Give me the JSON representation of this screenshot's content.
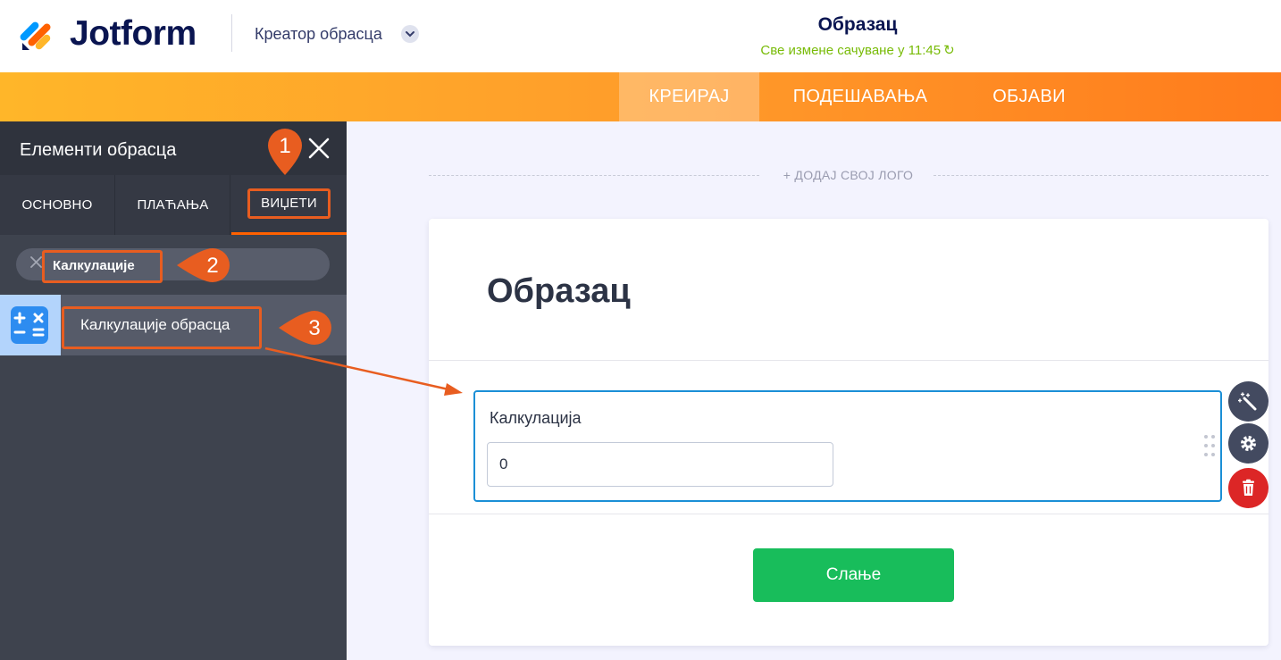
{
  "header": {
    "brand": "Jotform",
    "creator_label": "Креатор обрасца",
    "form_title": "Образац",
    "saved_status": "Све измене сачуване у 11:45"
  },
  "nav": {
    "tabs": [
      {
        "label": "КРЕИРАЈ",
        "active": true
      },
      {
        "label": "ПОДЕШАВАЊА",
        "active": false
      },
      {
        "label": "ОБЈАВИ",
        "active": false
      }
    ]
  },
  "panel": {
    "title": "Елементи обрасца",
    "tabs": [
      "ОСНОВНО",
      "ПЛАЋАЊА",
      "ВИЏЕТИ"
    ],
    "search_value": "Калкулације",
    "result_label": "Калкулације обрасца"
  },
  "canvas": {
    "add_logo": "+ ДОДАЈ СВОЈ ЛОГО",
    "title": "Образац",
    "field_label": "Калкулација",
    "field_value": "0",
    "submit_label": "Слање"
  },
  "annotations": {
    "step1": "1",
    "step2": "2",
    "step3": "3"
  },
  "colors": {
    "brand_navy": "#0a1551",
    "nav_orange": "#ff9a2a",
    "highlight": "#e85d20",
    "saved_green": "#78bb07",
    "submit_green": "#18bd5b",
    "field_focus": "#1b8fd6",
    "delete_red": "#dc2626"
  },
  "icons": [
    "jotform-logo-icon",
    "chevron-down-icon",
    "refresh-icon",
    "close-icon",
    "clear-search-icon",
    "calculator-icon",
    "drag-handle-icon",
    "magic-wand-icon",
    "gear-icon",
    "trash-icon"
  ]
}
